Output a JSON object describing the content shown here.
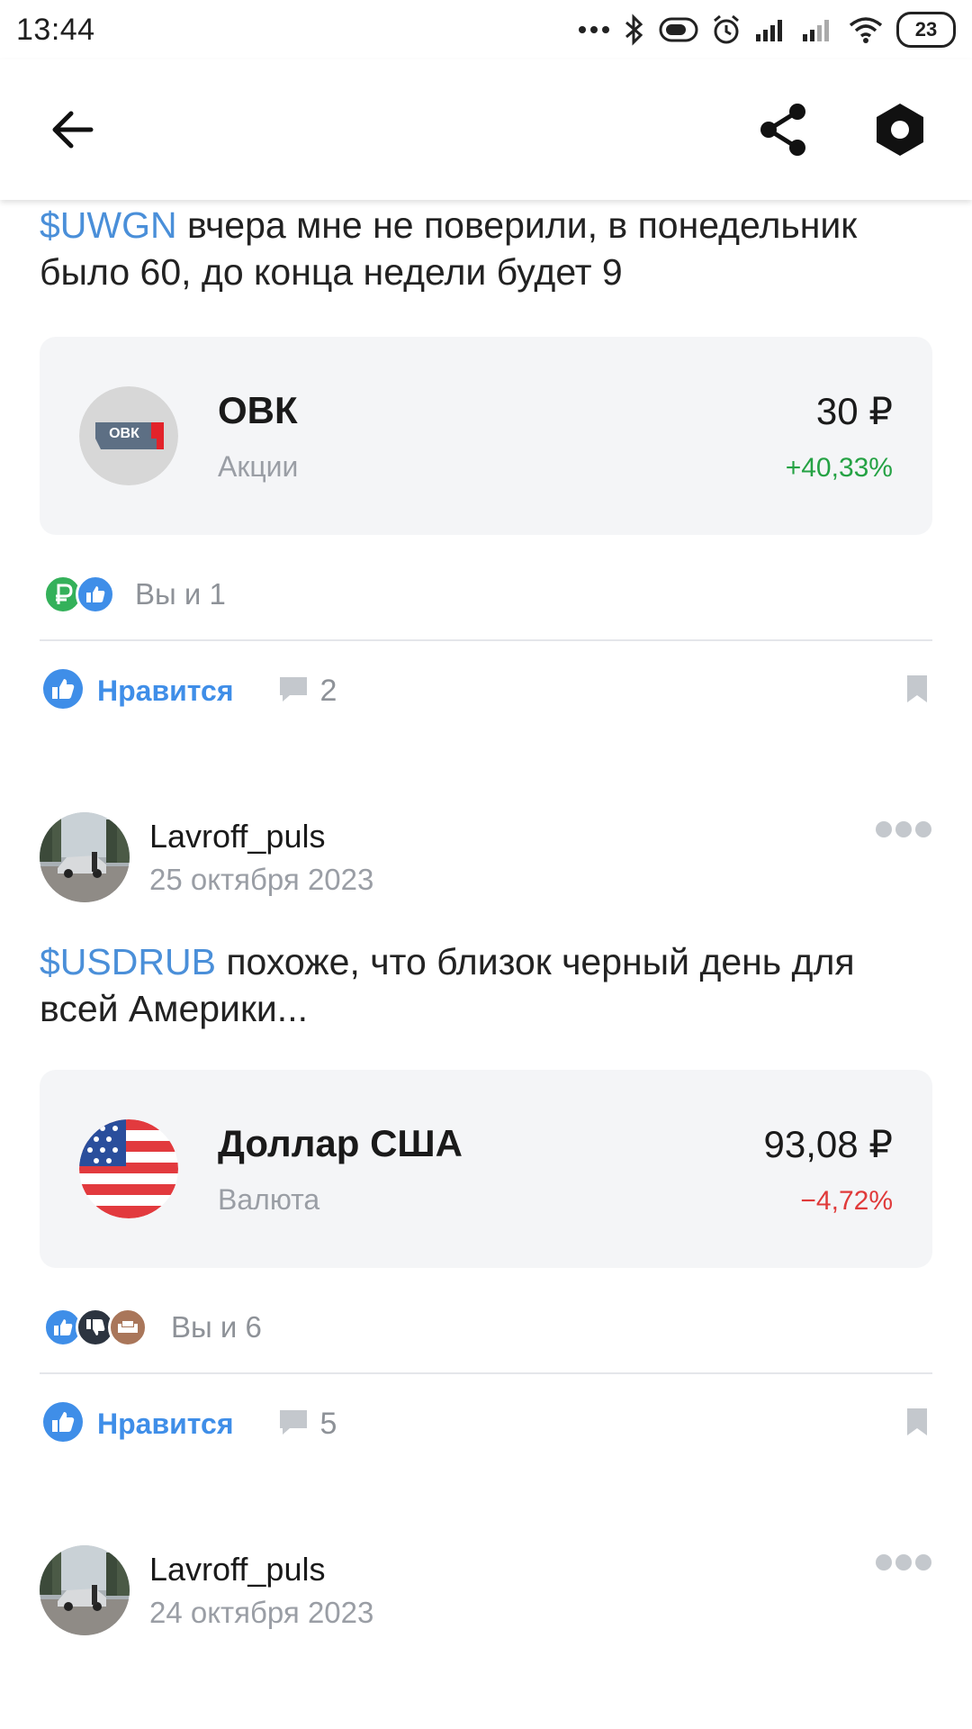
{
  "status_bar": {
    "time": "13:44",
    "battery": "23",
    "icons": [
      "dots-icon",
      "bluetooth-icon",
      "toggle-icon",
      "alarm-icon",
      "signal-icon",
      "signal-icon",
      "wifi-icon",
      "battery-icon"
    ]
  },
  "top_bar": {
    "back_icon": "arrow-left-icon",
    "share_icon": "share-icon",
    "settings_icon": "hexagon-settings-icon"
  },
  "posts": [
    {
      "text_ticker": "$UWGN",
      "text_body": " вчера мне не поверили, в понедельник было 60, до конца недели будет 9",
      "instrument": {
        "name": "ОВК",
        "logo_text": "ОВК",
        "type": "Акции",
        "price": "30 ₽",
        "change": "+40,33%"
      },
      "reactions_text": "Вы и 1",
      "like_label": "Нравится",
      "comment_count": "2"
    },
    {
      "author": "Lavroff_puls",
      "date": "25 октября 2023",
      "text_ticker": "$USDRUB",
      "text_body": " похоже, что близок черный день для всей Америки...",
      "instrument": {
        "name": "Доллар США",
        "type": "Валюта",
        "price": "93,08 ₽",
        "change": "−4,72%"
      },
      "reactions_text": "Вы и 6",
      "like_label": "Нравится",
      "comment_count": "5"
    },
    {
      "author": "Lavroff_puls",
      "date": "24 октября 2023"
    }
  ],
  "colors": {
    "accent": "#3f8ee8",
    "ticker": "#4a8fd9",
    "positive": "#25a244",
    "negative": "#e03a3a",
    "card_bg": "#f4f5f7"
  }
}
